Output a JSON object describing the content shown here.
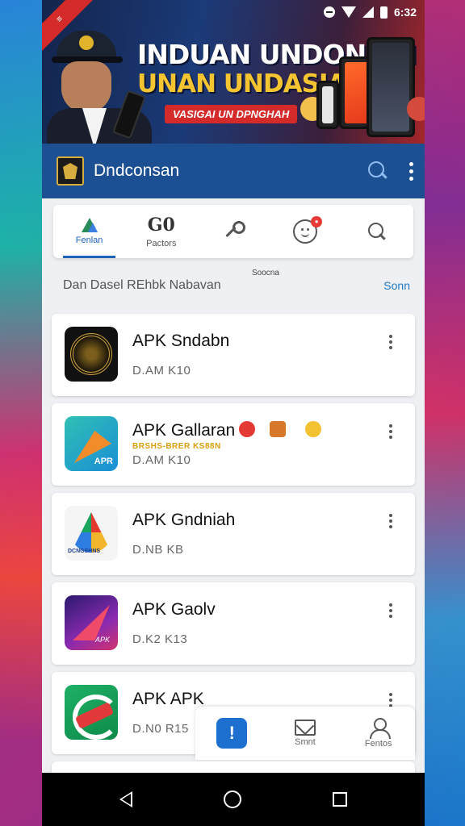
{
  "status_bar": {
    "time": "6:32"
  },
  "banner": {
    "ribbon": "≡",
    "title_line1": "INDUAN UNDONIAN",
    "title_line2": "UNAN UNDASIAN",
    "pill": "VASIGAI UN DPNGHAH"
  },
  "app_bar": {
    "title": "Dndconsan"
  },
  "tabs": [
    {
      "label": "Fenlan",
      "icon": "triangle-logo-icon"
    },
    {
      "label": "Pactors",
      "icon_text": "G0"
    },
    {
      "label": "",
      "icon": "wrench-icon"
    },
    {
      "label": "",
      "icon": "emoji-icon",
      "badge": "●"
    },
    {
      "label": "",
      "icon": "search-icon"
    }
  ],
  "section": {
    "caption": "Soocna",
    "title": "Dan Dasel REhbk Nabavan",
    "link": "Sonn"
  },
  "apps": [
    {
      "name": "APK Sndabn",
      "meta": "D.AM K10",
      "promo": ""
    },
    {
      "name": "APK Gallaran",
      "meta": "D.AM K10",
      "promo": "BRSHS-BRER KS88N"
    },
    {
      "name": "APK Gndniah",
      "meta": "D.NB KB",
      "promo": ""
    },
    {
      "name": "APK Gaolv",
      "meta": "D.K2 K13",
      "promo": ""
    },
    {
      "name": "APK APK",
      "meta": "D.N0 R15",
      "promo": ""
    }
  ],
  "app_icon_labels": {
    "apr": "APR",
    "swirl": "DCNGSHNS",
    "purple": "APK"
  },
  "bottom_nav": [
    {
      "label": "",
      "icon_text": "!"
    },
    {
      "label": "Smnt"
    },
    {
      "label": "Fentos"
    }
  ],
  "colors": {
    "app_bar": "#1d4f93",
    "accent": "#1d63b8",
    "banner_gold": "#f5c431"
  }
}
